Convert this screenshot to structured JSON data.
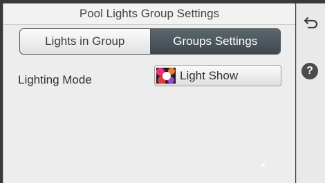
{
  "header": {
    "title": "Pool Lights Group Settings"
  },
  "tabs": [
    {
      "label": "Lights in Group",
      "selected": false
    },
    {
      "label": "Groups Settings",
      "selected": true
    }
  ],
  "lighting_mode": {
    "label": "Lighting Mode",
    "value": "Light Show",
    "icon": "light-show-icon"
  },
  "sidebar": {
    "back_icon": "back-arrow-icon",
    "help_icon": "help-icon",
    "help_glyph": "?"
  },
  "colors": {
    "active_tab": "#4b555c",
    "background": "#ededed"
  }
}
